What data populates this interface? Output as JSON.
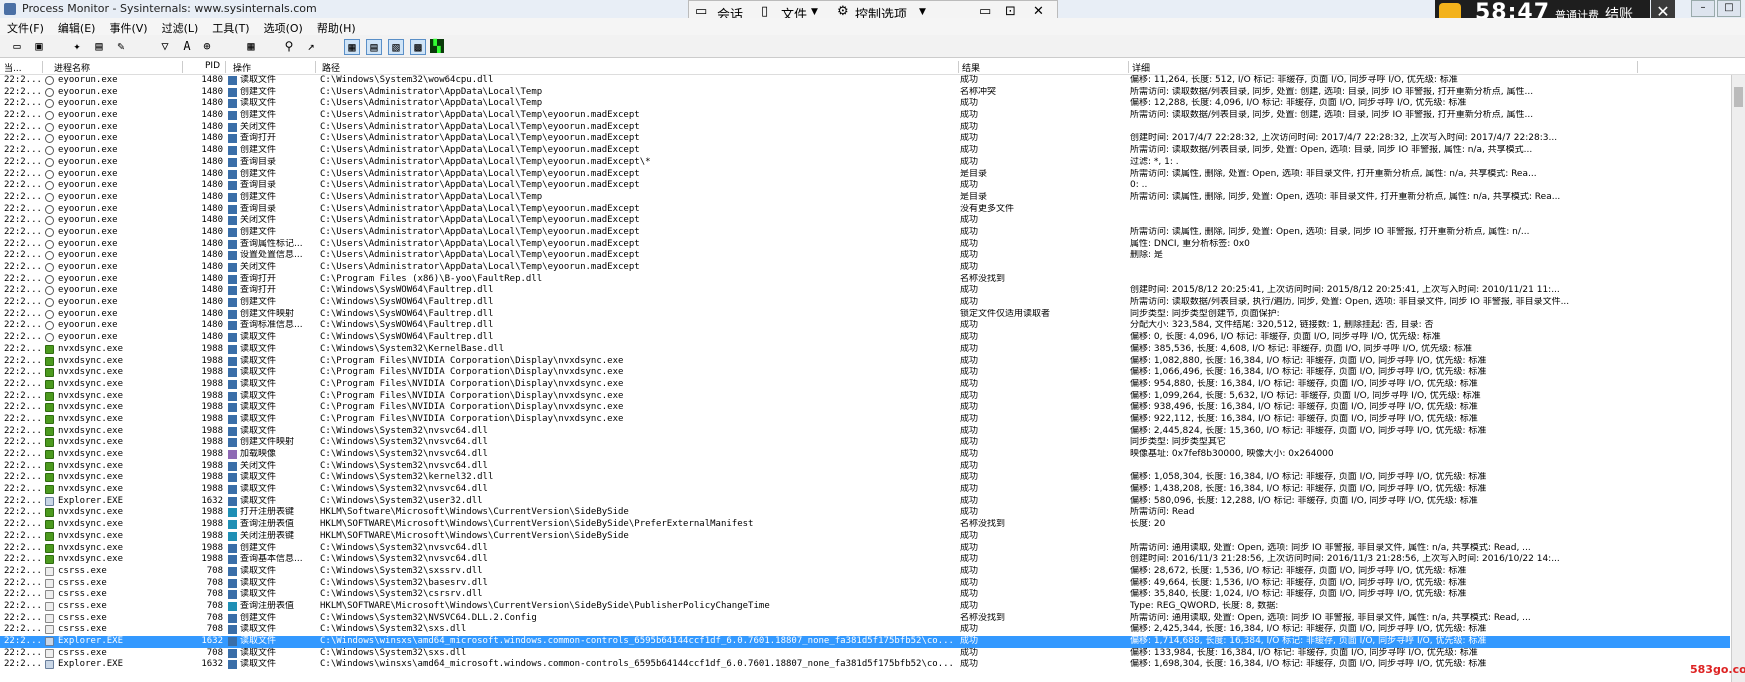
{
  "window": {
    "title": "Process Monitor - Sysinternals: www.sysinternals.com"
  },
  "menu": [
    "文件(F)",
    "编辑(E)",
    "事件(V)",
    "过滤(L)",
    "工具(T)",
    "选项(O)",
    "帮助(H)"
  ],
  "overlay": {
    "session": "会话",
    "file": "文件",
    "controls": "控制选项"
  },
  "timer": {
    "time": "58:47",
    "mode": "普通计费",
    "end": "结账",
    "close": "✕"
  },
  "columns": [
    "当...",
    "进程名称",
    "PID",
    "操作",
    "路径",
    "结果",
    "详细"
  ],
  "rows": [
    {
      "t": "22:2...",
      "proc": "eyoorun.exe",
      "pid": "1480",
      "op": "读取文件",
      "path": "C:\\Windows\\System32\\wow64cpu.dll",
      "res": "成功",
      "det": "偏移: 11,264, 长度: 512, I/O 标记: 非缓存, 页面 I/O, 同步寻呼 I/O, 优先级: 标准",
      "pk": "ey"
    },
    {
      "t": "22:2...",
      "proc": "eyoorun.exe",
      "pid": "1480",
      "op": "创建文件",
      "path": "C:\\Users\\Administrator\\AppData\\Local\\Temp",
      "res": "名称冲突",
      "det": "所需访问: 读取数据/列表目录, 同步, 处置: 创建, 选项: 目录, 同步 IO 非警报, 打开重新分析点, 属性...",
      "pk": "ey"
    },
    {
      "t": "22:2...",
      "proc": "eyoorun.exe",
      "pid": "1480",
      "op": "读取文件",
      "path": "C:\\Users\\Administrator\\AppData\\Local\\Temp",
      "res": "成功",
      "det": "偏移: 12,288, 长度: 4,096, I/O 标记: 非缓存, 页面 I/O, 同步寻呼 I/O, 优先级: 标准",
      "pk": "ey"
    },
    {
      "t": "22:2...",
      "proc": "eyoorun.exe",
      "pid": "1480",
      "op": "创建文件",
      "path": "C:\\Users\\Administrator\\AppData\\Local\\Temp\\eyoorun.madExcept",
      "res": "成功",
      "det": "所需访问: 读取数据/列表目录, 同步, 处置: 创建, 选项: 目录, 同步 IO 非警报, 打开重新分析点, 属性...",
      "pk": "ey"
    },
    {
      "t": "22:2...",
      "proc": "eyoorun.exe",
      "pid": "1480",
      "op": "关闭文件",
      "path": "C:\\Users\\Administrator\\AppData\\Local\\Temp\\eyoorun.madExcept",
      "res": "成功",
      "det": "",
      "pk": "ey"
    },
    {
      "t": "22:2...",
      "proc": "eyoorun.exe",
      "pid": "1480",
      "op": "查询打开",
      "path": "C:\\Users\\Administrator\\AppData\\Local\\Temp\\eyoorun.madExcept",
      "res": "成功",
      "det": "创建时间: 2017/4/7 22:28:32, 上次访问时间: 2017/4/7 22:28:32, 上次写入时间: 2017/4/7 22:28:3...",
      "pk": "ey"
    },
    {
      "t": "22:2...",
      "proc": "eyoorun.exe",
      "pid": "1480",
      "op": "创建文件",
      "path": "C:\\Users\\Administrator\\AppData\\Local\\Temp\\eyoorun.madExcept",
      "res": "成功",
      "det": "所需访问: 读取数据/列表目录, 同步, 处置: Open, 选项: 目录, 同步 IO 非警报, 属性: n/a, 共享模式...",
      "pk": "ey"
    },
    {
      "t": "22:2...",
      "proc": "eyoorun.exe",
      "pid": "1480",
      "op": "查询目录",
      "path": "C:\\Users\\Administrator\\AppData\\Local\\Temp\\eyoorun.madExcept\\*",
      "res": "成功",
      "det": "过滤: *, 1: .",
      "pk": "ey"
    },
    {
      "t": "22:2...",
      "proc": "eyoorun.exe",
      "pid": "1480",
      "op": "创建文件",
      "path": "C:\\Users\\Administrator\\AppData\\Local\\Temp\\eyoorun.madExcept",
      "res": "是目录",
      "det": "所需访问: 读属性, 删除, 处置: Open, 选项: 非目录文件, 打开重新分析点, 属性: n/a, 共享模式: Rea...",
      "pk": "ey"
    },
    {
      "t": "22:2...",
      "proc": "eyoorun.exe",
      "pid": "1480",
      "op": "查询目录",
      "path": "C:\\Users\\Administrator\\AppData\\Local\\Temp\\eyoorun.madExcept",
      "res": "成功",
      "det": "0: ..",
      "pk": "ey"
    },
    {
      "t": "22:2...",
      "proc": "eyoorun.exe",
      "pid": "1480",
      "op": "创建文件",
      "path": "C:\\Users\\Administrator\\AppData\\Local\\Temp",
      "res": "是目录",
      "det": "所需访问: 读属性, 删除, 同步, 处置: Open, 选项: 非目录文件, 打开重新分析点, 属性: n/a, 共享模式: Rea...",
      "pk": "ey"
    },
    {
      "t": "22:2...",
      "proc": "eyoorun.exe",
      "pid": "1480",
      "op": "查询目录",
      "path": "C:\\Users\\Administrator\\AppData\\Local\\Temp\\eyoorun.madExcept",
      "res": "没有更多文件",
      "det": "",
      "pk": "ey"
    },
    {
      "t": "22:2...",
      "proc": "eyoorun.exe",
      "pid": "1480",
      "op": "关闭文件",
      "path": "C:\\Users\\Administrator\\AppData\\Local\\Temp\\eyoorun.madExcept",
      "res": "成功",
      "det": "",
      "pk": "ey"
    },
    {
      "t": "22:2...",
      "proc": "eyoorun.exe",
      "pid": "1480",
      "op": "创建文件",
      "path": "C:\\Users\\Administrator\\AppData\\Local\\Temp\\eyoorun.madExcept",
      "res": "成功",
      "det": "所需访问: 读属性, 删除, 同步, 处置: Open, 选项: 目录, 同步 IO 非警报, 打开重新分析点, 属性: n/...",
      "pk": "ey"
    },
    {
      "t": "22:2...",
      "proc": "eyoorun.exe",
      "pid": "1480",
      "op": "查询属性标记...",
      "path": "C:\\Users\\Administrator\\AppData\\Local\\Temp\\eyoorun.madExcept",
      "res": "成功",
      "det": "属性: DNCI, 重分析标签: 0x0",
      "pk": "ey"
    },
    {
      "t": "22:2...",
      "proc": "eyoorun.exe",
      "pid": "1480",
      "op": "设置处置信息...",
      "path": "C:\\Users\\Administrator\\AppData\\Local\\Temp\\eyoorun.madExcept",
      "res": "成功",
      "det": "删除: 是",
      "pk": "ey"
    },
    {
      "t": "22:2...",
      "proc": "eyoorun.exe",
      "pid": "1480",
      "op": "关闭文件",
      "path": "C:\\Users\\Administrator\\AppData\\Local\\Temp\\eyoorun.madExcept",
      "res": "成功",
      "det": "",
      "pk": "ey"
    },
    {
      "t": "22:2...",
      "proc": "eyoorun.exe",
      "pid": "1480",
      "op": "查询打开",
      "path": "C:\\Program Files (x86)\\B-yoo\\FaultRep.dll",
      "res": "名称没找到",
      "det": "",
      "pk": "ey"
    },
    {
      "t": "22:2...",
      "proc": "eyoorun.exe",
      "pid": "1480",
      "op": "查询打开",
      "path": "C:\\Windows\\SysWOW64\\Faultrep.dll",
      "res": "成功",
      "det": "创建时间: 2015/8/12 20:25:41, 上次访问时间: 2015/8/12 20:25:41, 上次写入时间: 2010/11/21 11:...",
      "pk": "ey"
    },
    {
      "t": "22:2...",
      "proc": "eyoorun.exe",
      "pid": "1480",
      "op": "创建文件",
      "path": "C:\\Windows\\SysWOW64\\Faultrep.dll",
      "res": "成功",
      "det": "所需访问: 读取数据/列表目录, 执行/遍历, 同步, 处置: Open, 选项: 非目录文件, 同步 IO 非警报, 非目录文件...",
      "pk": "ey"
    },
    {
      "t": "22:2...",
      "proc": "eyoorun.exe",
      "pid": "1480",
      "op": "创建文件映射",
      "path": "C:\\Windows\\SysWOW64\\Faultrep.dll",
      "res": "锁定文件仅适用读取者",
      "det": "同步类型: 同步类型创建节, 页面保护:",
      "pk": "ey"
    },
    {
      "t": "22:2...",
      "proc": "eyoorun.exe",
      "pid": "1480",
      "op": "查询标准信息...",
      "path": "C:\\Windows\\SysWOW64\\Faultrep.dll",
      "res": "成功",
      "det": "分配大小: 323,584, 文件结尾: 320,512, 链接数: 1, 删除挂起: 否, 目录: 否",
      "pk": "ey"
    },
    {
      "t": "22:2...",
      "proc": "eyoorun.exe",
      "pid": "1480",
      "op": "读取文件",
      "path": "C:\\Windows\\SysWOW64\\Faultrep.dll",
      "res": "成功",
      "det": "偏移: 0, 长度: 4,096, I/O 标记: 非缓存, 页面 I/O, 同步寻呼 I/O, 优先级: 标准",
      "pk": "ey"
    },
    {
      "t": "22:2...",
      "proc": "nvxdsync.exe",
      "pid": "1988",
      "op": "读取文件",
      "path": "C:\\Windows\\System32\\KernelBase.dll",
      "res": "成功",
      "det": "偏移: 385,536, 长度: 4,608, I/O 标记: 非缓存, 页面 I/O, 同步寻呼 I/O, 优先级: 标准",
      "pk": "nv"
    },
    {
      "t": "22:2...",
      "proc": "nvxdsync.exe",
      "pid": "1988",
      "op": "读取文件",
      "path": "C:\\Program Files\\NVIDIA Corporation\\Display\\nvxdsync.exe",
      "res": "成功",
      "det": "偏移: 1,082,880, 长度: 16,384, I/O 标记: 非缓存, 页面 I/O, 同步寻呼 I/O, 优先级: 标准",
      "pk": "nv"
    },
    {
      "t": "22:2...",
      "proc": "nvxdsync.exe",
      "pid": "1988",
      "op": "读取文件",
      "path": "C:\\Program Files\\NVIDIA Corporation\\Display\\nvxdsync.exe",
      "res": "成功",
      "det": "偏移: 1,066,496, 长度: 16,384, I/O 标记: 非缓存, 页面 I/O, 同步寻呼 I/O, 优先级: 标准",
      "pk": "nv"
    },
    {
      "t": "22:2...",
      "proc": "nvxdsync.exe",
      "pid": "1988",
      "op": "读取文件",
      "path": "C:\\Program Files\\NVIDIA Corporation\\Display\\nvxdsync.exe",
      "res": "成功",
      "det": "偏移: 954,880, 长度: 16,384, I/O 标记: 非缓存, 页面 I/O, 同步寻呼 I/O, 优先级: 标准",
      "pk": "nv"
    },
    {
      "t": "22:2...",
      "proc": "nvxdsync.exe",
      "pid": "1988",
      "op": "读取文件",
      "path": "C:\\Program Files\\NVIDIA Corporation\\Display\\nvxdsync.exe",
      "res": "成功",
      "det": "偏移: 1,099,264, 长度: 5,632, I/O 标记: 非缓存, 页面 I/O, 同步寻呼 I/O, 优先级: 标准",
      "pk": "nv"
    },
    {
      "t": "22:2...",
      "proc": "nvxdsync.exe",
      "pid": "1988",
      "op": "读取文件",
      "path": "C:\\Program Files\\NVIDIA Corporation\\Display\\nvxdsync.exe",
      "res": "成功",
      "det": "偏移: 938,496, 长度: 16,384, I/O 标记: 非缓存, 页面 I/O, 同步寻呼 I/O, 优先级: 标准",
      "pk": "nv"
    },
    {
      "t": "22:2...",
      "proc": "nvxdsync.exe",
      "pid": "1988",
      "op": "读取文件",
      "path": "C:\\Program Files\\NVIDIA Corporation\\Display\\nvxdsync.exe",
      "res": "成功",
      "det": "偏移: 922,112, 长度: 16,384, I/O 标记: 非缓存, 页面 I/O, 同步寻呼 I/O, 优先级: 标准",
      "pk": "nv"
    },
    {
      "t": "22:2...",
      "proc": "nvxdsync.exe",
      "pid": "1988",
      "op": "读取文件",
      "path": "C:\\Windows\\System32\\nvsvc64.dll",
      "res": "成功",
      "det": "偏移: 2,445,824, 长度: 15,360, I/O 标记: 非缓存, 页面 I/O, 同步寻呼 I/O, 优先级: 标准",
      "pk": "nv"
    },
    {
      "t": "22:2...",
      "proc": "nvxdsync.exe",
      "pid": "1988",
      "op": "创建文件映射",
      "path": "C:\\Windows\\System32\\nvsvc64.dll",
      "res": "成功",
      "det": "同步类型: 同步类型其它",
      "pk": "nv"
    },
    {
      "t": "22:2...",
      "proc": "nvxdsync.exe",
      "pid": "1988",
      "op": "加载映像",
      "path": "C:\\Windows\\System32\\nvsvc64.dll",
      "res": "成功",
      "det": "映像基址: 0x7fef8b30000, 映像大小: 0x264000",
      "pk": "nv"
    },
    {
      "t": "22:2...",
      "proc": "nvxdsync.exe",
      "pid": "1988",
      "op": "关闭文件",
      "path": "C:\\Windows\\System32\\nvsvc64.dll",
      "res": "成功",
      "det": "",
      "pk": "nv"
    },
    {
      "t": "22:2...",
      "proc": "nvxdsync.exe",
      "pid": "1988",
      "op": "读取文件",
      "path": "C:\\Windows\\System32\\kernel32.dll",
      "res": "成功",
      "det": "偏移: 1,058,304, 长度: 16,384, I/O 标记: 非缓存, 页面 I/O, 同步寻呼 I/O, 优先级: 标准",
      "pk": "nv"
    },
    {
      "t": "22:2...",
      "proc": "nvxdsync.exe",
      "pid": "1988",
      "op": "读取文件",
      "path": "C:\\Windows\\System32\\nvsvc64.dll",
      "res": "成功",
      "det": "偏移: 1,438,208, 长度: 16,384, I/O 标记: 非缓存, 页面 I/O, 同步寻呼 I/O, 优先级: 标准",
      "pk": "nv"
    },
    {
      "t": "22:2...",
      "proc": "Explorer.EXE",
      "pid": "1632",
      "op": "读取文件",
      "path": "C:\\Windows\\System32\\user32.dll",
      "res": "成功",
      "det": "偏移: 580,096, 长度: 12,288, I/O 标记: 非缓存, 页面 I/O, 同步寻呼 I/O, 优先级: 标准",
      "pk": "ex"
    },
    {
      "t": "22:2...",
      "proc": "nvxdsync.exe",
      "pid": "1988",
      "op": "打开注册表键",
      "path": "HKLM\\Software\\Microsoft\\Windows\\CurrentVersion\\SideBySide",
      "res": "成功",
      "det": "所需访问: Read",
      "pk": "nv"
    },
    {
      "t": "22:2...",
      "proc": "nvxdsync.exe",
      "pid": "1988",
      "op": "查询注册表值",
      "path": "HKLM\\SOFTWARE\\Microsoft\\Windows\\CurrentVersion\\SideBySide\\PreferExternalManifest",
      "res": "名称没找到",
      "det": "长度: 20",
      "pk": "nv"
    },
    {
      "t": "22:2...",
      "proc": "nvxdsync.exe",
      "pid": "1988",
      "op": "关闭注册表键",
      "path": "HKLM\\SOFTWARE\\Microsoft\\Windows\\CurrentVersion\\SideBySide",
      "res": "成功",
      "det": "",
      "pk": "nv"
    },
    {
      "t": "22:2...",
      "proc": "nvxdsync.exe",
      "pid": "1988",
      "op": "创建文件",
      "path": "C:\\Windows\\System32\\nvsvc64.dll",
      "res": "成功",
      "det": "所需访问: 通用读取, 处置: Open, 选项: 同步 IO 非警报, 非目录文件, 属性: n/a, 共享模式: Read, ...",
      "pk": "nv"
    },
    {
      "t": "22:2...",
      "proc": "nvxdsync.exe",
      "pid": "1988",
      "op": "查询基本信息...",
      "path": "C:\\Windows\\System32\\nvsvc64.dll",
      "res": "成功",
      "det": "创建时间: 2016/11/3 21:28:56, 上次访问时间: 2016/11/3 21:28:56, 上次写入时间: 2016/10/22 14:...",
      "pk": "nv"
    },
    {
      "t": "22:2...",
      "proc": "csrss.exe",
      "pid": "708",
      "op": "读取文件",
      "path": "C:\\Windows\\System32\\sxssrv.dll",
      "res": "成功",
      "det": "偏移: 28,672, 长度: 1,536, I/O 标记: 非缓存, 页面 I/O, 同步寻呼 I/O, 优先级: 标准",
      "pk": "cs"
    },
    {
      "t": "22:2...",
      "proc": "csrss.exe",
      "pid": "708",
      "op": "读取文件",
      "path": "C:\\Windows\\System32\\basesrv.dll",
      "res": "成功",
      "det": "偏移: 49,664, 长度: 1,536, I/O 标记: 非缓存, 页面 I/O, 同步寻呼 I/O, 优先级: 标准",
      "pk": "cs"
    },
    {
      "t": "22:2...",
      "proc": "csrss.exe",
      "pid": "708",
      "op": "读取文件",
      "path": "C:\\Windows\\System32\\csrsrv.dll",
      "res": "成功",
      "det": "偏移: 35,840, 长度: 1,024, I/O 标记: 非缓存, 页面 I/O, 同步寻呼 I/O, 优先级: 标准",
      "pk": "cs"
    },
    {
      "t": "22:2...",
      "proc": "csrss.exe",
      "pid": "708",
      "op": "查询注册表值",
      "path": "HKLM\\SOFTWARE\\Microsoft\\Windows\\CurrentVersion\\SideBySide\\PublisherPolicyChangeTime",
      "res": "成功",
      "det": "Type: REG_QWORD, 长度: 8, 数据:",
      "pk": "cs"
    },
    {
      "t": "22:2...",
      "proc": "csrss.exe",
      "pid": "708",
      "op": "创建文件",
      "path": "C:\\Windows\\System32\\NVSVC64.DLL.2.Config",
      "res": "名称没找到",
      "det": "所需访问: 通用读取, 处置: Open, 选项: 同步 IO 非警报, 非目录文件, 属性: n/a, 共享模式: Read, ...",
      "pk": "cs"
    },
    {
      "t": "22:2...",
      "proc": "csrss.exe",
      "pid": "708",
      "op": "读取文件",
      "path": "C:\\Windows\\System32\\sxs.dll",
      "res": "成功",
      "det": "偏移: 2,425,344, 长度: 16,384, I/O 标记: 非缓存, 页面 I/O, 同步寻呼 I/O, 优先级: 标准",
      "pk": "cs"
    },
    {
      "t": "22:2...",
      "proc": "Explorer.EXE",
      "pid": "1632",
      "op": "读取文件",
      "path": "C:\\Windows\\winsxs\\amd64_microsoft.windows.common-controls_6595b64144ccf1df_6.0.7601.18807_none_fa381d5f175bfb52\\co...",
      "res": "成功",
      "det": "偏移: 1,714,688, 长度: 16,384, I/O 标记: 非缓存, 页面 I/O, 同步寻呼 I/O, 优先级: 标准",
      "pk": "ex",
      "sel": true
    },
    {
      "t": "22:2...",
      "proc": "csrss.exe",
      "pid": "708",
      "op": "读取文件",
      "path": "C:\\Windows\\System32\\sxs.dll",
      "res": "成功",
      "det": "偏移: 133,984, 长度: 16,384, I/O 标记: 非缓存, 页面 I/O, 同步寻呼 I/O, 优先级: 标准",
      "pk": "cs"
    },
    {
      "t": "22:2...",
      "proc": "Explorer.EXE",
      "pid": "1632",
      "op": "读取文件",
      "path": "C:\\Windows\\winsxs\\amd64_microsoft.windows.common-controls_6595b64144ccf1df_6.0.7601.18807_none_fa381d5f175bfb52\\co...",
      "res": "成功",
      "det": "偏移: 1,698,304, 长度: 16,384, I/O 标记: 非缓存, 页面 I/O, 同步寻呼 I/O, 优先级: 标准",
      "pk": "ex"
    }
  ],
  "watermark": "583go.com"
}
